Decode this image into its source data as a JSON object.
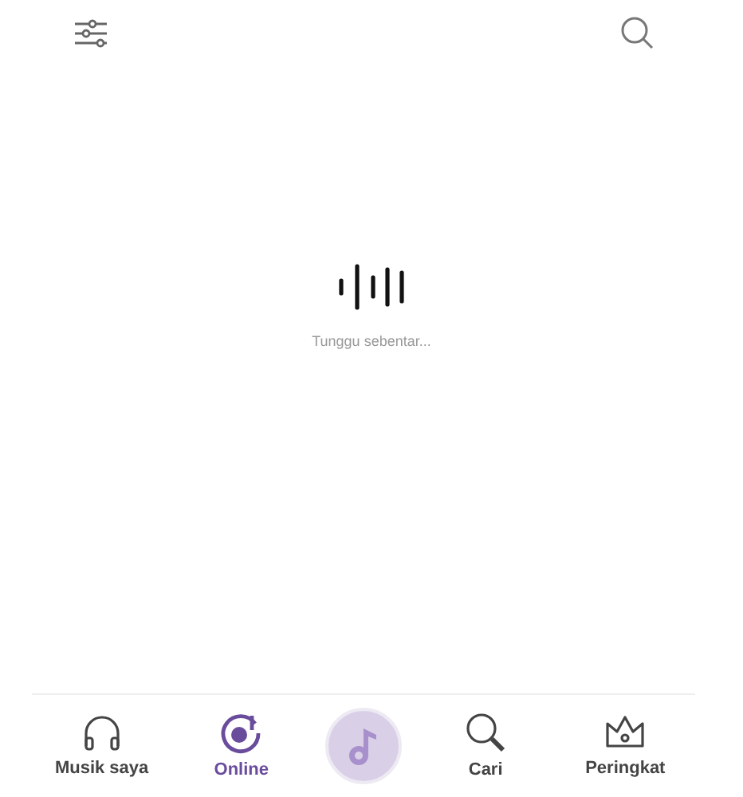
{
  "loading": {
    "message": "Tunggu sebentar..."
  },
  "nav": [
    {
      "kind": "tab",
      "label": "Musik saya",
      "selected": false
    },
    {
      "kind": "tab",
      "label": "Online",
      "selected": true
    },
    {
      "kind": "player"
    },
    {
      "kind": "tab",
      "label": "Cari",
      "selected": false
    },
    {
      "kind": "tab",
      "label": "Peringkat",
      "selected": false
    }
  ]
}
